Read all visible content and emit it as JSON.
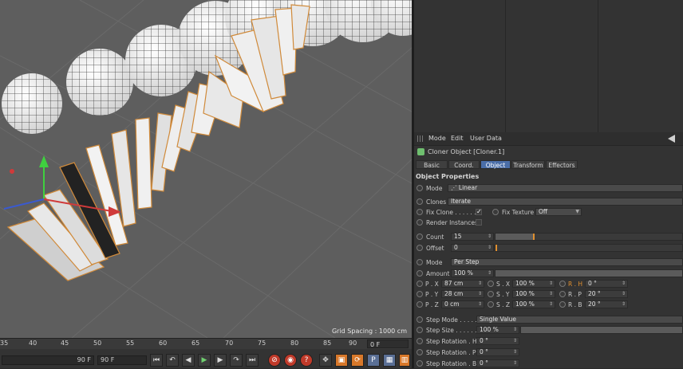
{
  "viewport": {
    "grid_spacing": "Grid Spacing : 1000 cm"
  },
  "timeline": {
    "ticks": [
      "35",
      "40",
      "45",
      "50",
      "55",
      "60",
      "65",
      "70",
      "75",
      "80",
      "85",
      "90"
    ],
    "current_frame": "0 F"
  },
  "transport": {
    "field_left": "90 F",
    "field_right": "90 F"
  },
  "attributes": {
    "menu": {
      "mode": "Mode",
      "edit": "Edit",
      "user_data": "User Data"
    },
    "object_title": "Cloner Object [Cloner.1]",
    "tabs": [
      "Basic",
      "Coord.",
      "Object",
      "Transform",
      "Effectors"
    ],
    "active_tab": "Object",
    "section_title": "Object Properties",
    "mode_label": "Mode",
    "mode_value": "Linear",
    "clones_label": "Clones",
    "clones_value": "Iterate",
    "fix_clone_label": "Fix Clone . . . . . . .",
    "fix_clone_checked": "✓",
    "fix_texture_label": "Fix Texture",
    "fix_texture_value": "Off",
    "render_instances_label": "Render Instances",
    "count_label": "Count",
    "count_value": "15",
    "count_fraction": 0.2,
    "offset_label": "Offset",
    "offset_value": "0",
    "mode2_label": "Mode",
    "mode2_value": "Per Step",
    "amount_label": "Amount",
    "amount_value": "100 %",
    "px_label": "P . X",
    "px_value": "87 cm",
    "py_label": "P . Y",
    "py_value": "28 cm",
    "pz_label": "P . Z",
    "pz_value": "0 cm",
    "sx_label": "S . X",
    "sx_value": "100 %",
    "sy_label": "S . Y",
    "sy_value": "100 %",
    "sz_label": "S . Z",
    "sz_value": "100 %",
    "rh_label": "R . H",
    "rh_value": "0 °",
    "rp_label": "R . P",
    "rp_value": "20 °",
    "rb_label": "R . B",
    "rb_value": "20 °",
    "step_mode_label": "Step Mode . . . . . .",
    "step_mode_value": "Single Value",
    "step_size_label": "Step Size . . . . . . .",
    "step_size_value": "100 %",
    "step_rot_h_label": "Step Rotation . H",
    "step_rot_h_value": "0 °",
    "step_rot_p_label": "Step Rotation . P",
    "step_rot_p_value": "0 °",
    "step_rot_b_label": "Step Rotation . B",
    "step_rot_b_value": "0 °"
  }
}
